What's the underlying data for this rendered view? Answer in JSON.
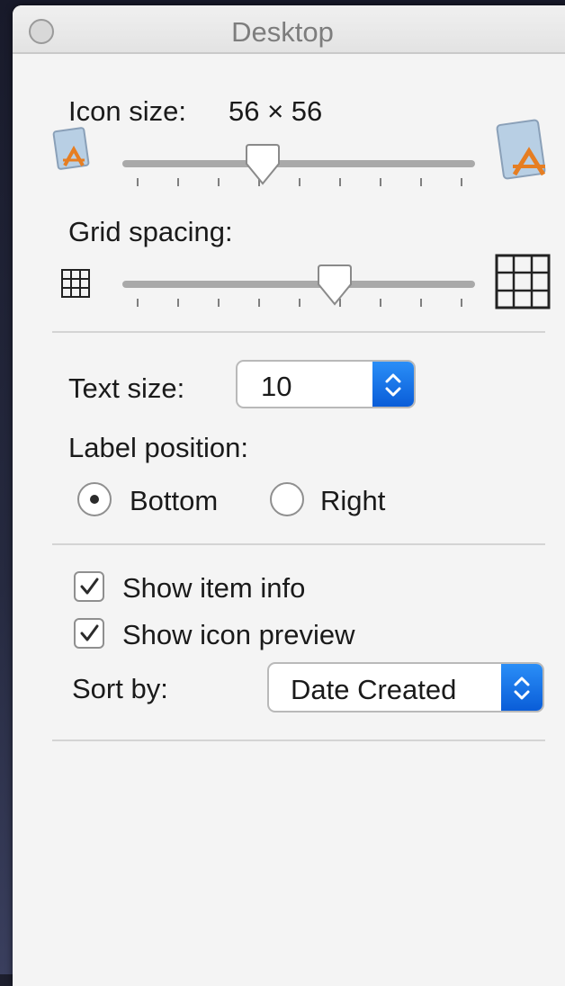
{
  "window": {
    "title": "Desktop"
  },
  "icon_size": {
    "label": "Icon size:",
    "value": "56 × 56",
    "slider_fraction": 0.385
  },
  "grid_spacing": {
    "label": "Grid spacing:",
    "slider_fraction": 0.615
  },
  "text_size": {
    "label": "Text size:",
    "value": "10"
  },
  "label_position": {
    "label": "Label position:",
    "options": [
      {
        "label": "Bottom",
        "selected": true
      },
      {
        "label": "Right",
        "selected": false
      }
    ]
  },
  "options": {
    "show_item_info": {
      "label": "Show item info",
      "checked": true
    },
    "show_icon_preview": {
      "label": "Show icon preview",
      "checked": true
    }
  },
  "sort_by": {
    "label": "Sort by:",
    "value": "Date Created"
  },
  "colors": {
    "accent": "#0a5dd8",
    "panel": "#f4f4f4"
  },
  "icons": [
    "close-icon",
    "app-icon-small",
    "app-icon-large",
    "grid-small-icon",
    "grid-large-icon",
    "chevron-updown-icon",
    "checkmark-icon"
  ]
}
